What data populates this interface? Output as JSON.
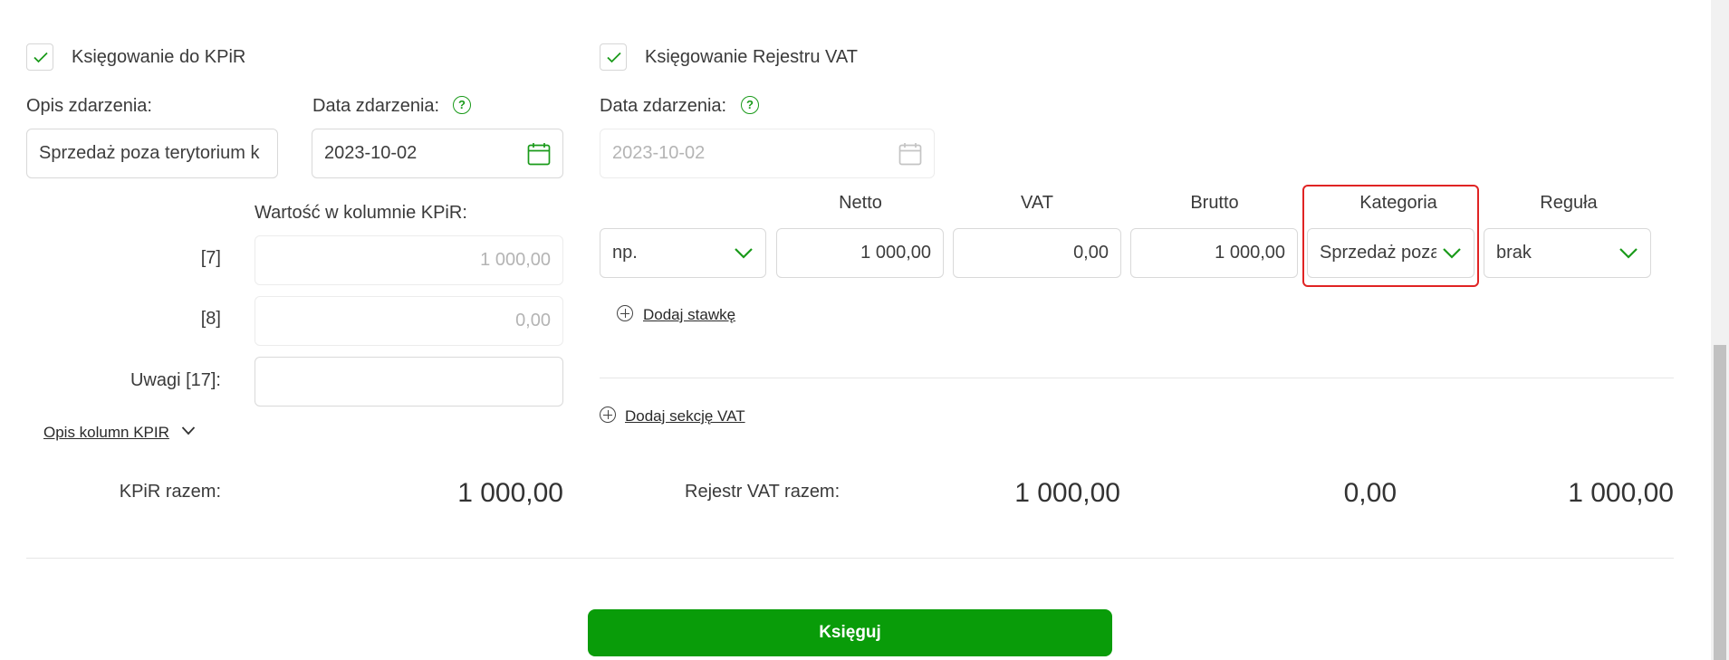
{
  "kpir": {
    "checkbox_label": "Księgowanie do KPiR",
    "checked": true,
    "opis_label": "Opis zdarzenia:",
    "opis_value": "Sprzedaż poza terytorium k",
    "data_label": "Data zdarzenia:",
    "data_value": "2023-10-02",
    "wartosc_label": "Wartość w kolumnie KPiR:",
    "rows": [
      {
        "label": "[7]",
        "value": "1 000,00"
      },
      {
        "label": "[8]",
        "value": "0,00"
      }
    ],
    "uwagi_label": "Uwagi [17]:",
    "uwagi_value": "",
    "opis_kolumn_link": "Opis kolumn KPIR",
    "total_label": "KPiR razem:",
    "total_value": "1 000,00"
  },
  "vat": {
    "checkbox_label": "Księgowanie Rejestru VAT",
    "checked": true,
    "data_label": "Data zdarzenia:",
    "data_value": "2023-10-02",
    "columns": {
      "netto": "Netto",
      "vat": "VAT",
      "brutto": "Brutto",
      "kategoria": "Kategoria",
      "regula": "Reguła"
    },
    "row": {
      "stawka": "np.",
      "netto": "1 000,00",
      "vat": "0,00",
      "brutto": "1 000,00",
      "kategoria": "Sprzedaż poza",
      "regula": "brak"
    },
    "dodaj_stawke": "Dodaj stawkę",
    "dodaj_sekcje": "Dodaj sekcję VAT",
    "total_label": "Rejestr VAT razem:",
    "total_netto": "1 000,00",
    "total_vat": "0,00",
    "total_brutto": "1 000,00"
  },
  "submit_label": "Księguj",
  "colors": {
    "accent": "#099c09",
    "highlight": "#e02424"
  },
  "icons": [
    "check-icon",
    "help-icon",
    "calendar-icon",
    "chevron-down-icon",
    "plus-circle-icon"
  ]
}
